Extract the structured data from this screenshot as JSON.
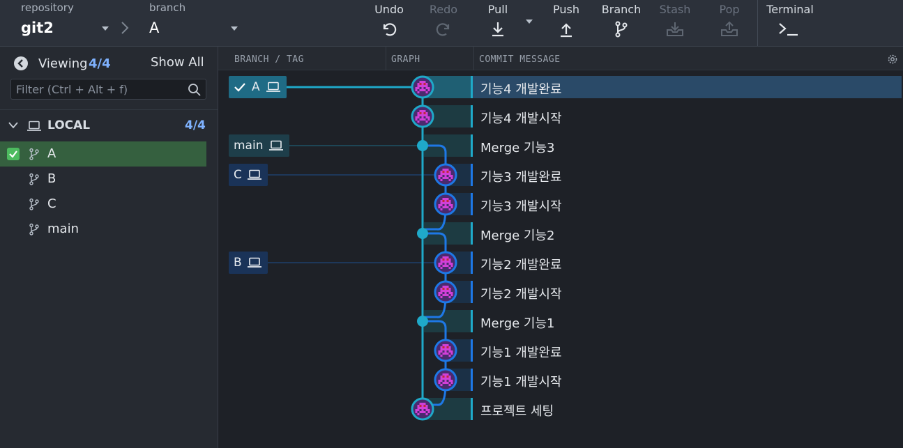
{
  "toolbar": {
    "repository_label": "repository",
    "repository_value": "git2",
    "branch_label": "branch",
    "branch_value": "A",
    "buttons": {
      "undo": "Undo",
      "redo": "Redo",
      "pull": "Pull",
      "push": "Push",
      "branch": "Branch",
      "stash": "Stash",
      "pop": "Pop",
      "terminal": "Terminal"
    }
  },
  "sidebar": {
    "viewing_label": "Viewing",
    "viewing_count": "4/4",
    "show_all": "Show All",
    "filter_placeholder": "Filter (Ctrl + Alt + f)",
    "local_label": "LOCAL",
    "local_count": "4/4",
    "branches": [
      {
        "name": "A",
        "checked": true
      },
      {
        "name": "B",
        "checked": false
      },
      {
        "name": "C",
        "checked": false
      },
      {
        "name": "main",
        "checked": false
      }
    ]
  },
  "graph": {
    "columns": {
      "branch_tag": "BRANCH / TAG",
      "graph": "GRAPH",
      "commit_message": "COMMIT MESSAGE"
    },
    "refs": [
      {
        "name": "A",
        "checked": true,
        "row": 0
      },
      {
        "name": "main",
        "checked": false,
        "row": 2
      },
      {
        "name": "C",
        "checked": false,
        "row": 3
      },
      {
        "name": "B",
        "checked": false,
        "row": 6
      }
    ],
    "commits": [
      {
        "message": "기능4 개발완료",
        "type": "avatar",
        "lane": 0
      },
      {
        "message": "기능4 개발시작",
        "type": "avatar",
        "lane": 0
      },
      {
        "message": "Merge 기능3",
        "type": "merge",
        "lane": 0
      },
      {
        "message": "기능3 개발완료",
        "type": "avatar",
        "lane": 1
      },
      {
        "message": "기능3 개발시작",
        "type": "avatar",
        "lane": 1
      },
      {
        "message": "Merge 기능2",
        "type": "merge",
        "lane": 0
      },
      {
        "message": "기능2 개발완료",
        "type": "avatar",
        "lane": 1
      },
      {
        "message": "기능2 개발시작",
        "type": "avatar",
        "lane": 1
      },
      {
        "message": "Merge 기능1",
        "type": "merge",
        "lane": 0
      },
      {
        "message": "기능1 개발완료",
        "type": "avatar",
        "lane": 1
      },
      {
        "message": "기능1 개발시작",
        "type": "avatar",
        "lane": 1
      },
      {
        "message": "프로젝트 세팅",
        "type": "avatar",
        "lane": 0
      }
    ],
    "selected_row": 0,
    "colors": {
      "lane0": "#1fa9c9",
      "lane1": "#1e78e6",
      "avatar_bg": "#4a2a6e",
      "avatar_fg": "#d040d8",
      "avatar_face": "#c0283a"
    }
  }
}
